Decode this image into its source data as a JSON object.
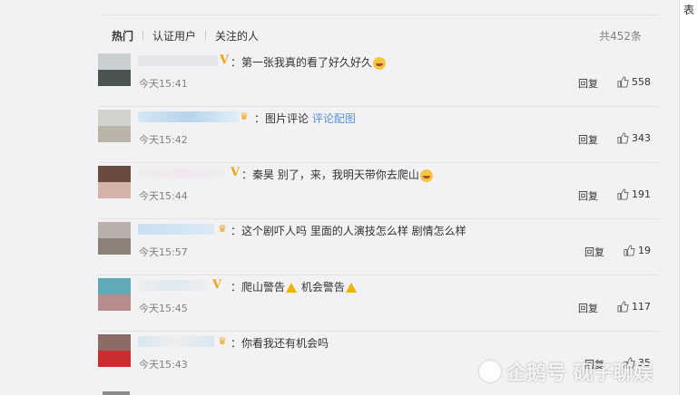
{
  "tabs": {
    "hot": "热门",
    "verified": "认证用户",
    "following": "关注的人"
  },
  "total_count": "共452条",
  "reply_label": "回复",
  "right_strip_char": "表",
  "comments": [
    {
      "text": "：第一张我真的看了好久好久",
      "time": "今天15:41",
      "likes": "558",
      "badge": "V"
    },
    {
      "text": "：图片评论 ",
      "link": "评论配图",
      "time": "今天15:42",
      "likes": "343",
      "badge": "crown"
    },
    {
      "text": "：秦昊 别了，来，我明天带你去爬山",
      "time": "今天15:44",
      "likes": "191",
      "badge": "V"
    },
    {
      "text": "：这个剧吓人吗 里面的人演技怎么样 剧情怎么样",
      "time": "今天15:57",
      "likes": "19",
      "badge": "crown"
    },
    {
      "text_a": "：爬山警告",
      "text_b": " 机会警告",
      "time": "今天15:45",
      "likes": "117",
      "badge": "V"
    },
    {
      "text": "：你看我还有机会吗",
      "time": "今天15:43",
      "likes": "35",
      "badge": "crown"
    }
  ],
  "watermark": "企鹅号 砚子聊娱",
  "icons": [
    "thumb-up-icon",
    "crown-icon",
    "verified-v-icon",
    "warning-icon",
    "emoji-icon",
    "penguin-icon"
  ]
}
